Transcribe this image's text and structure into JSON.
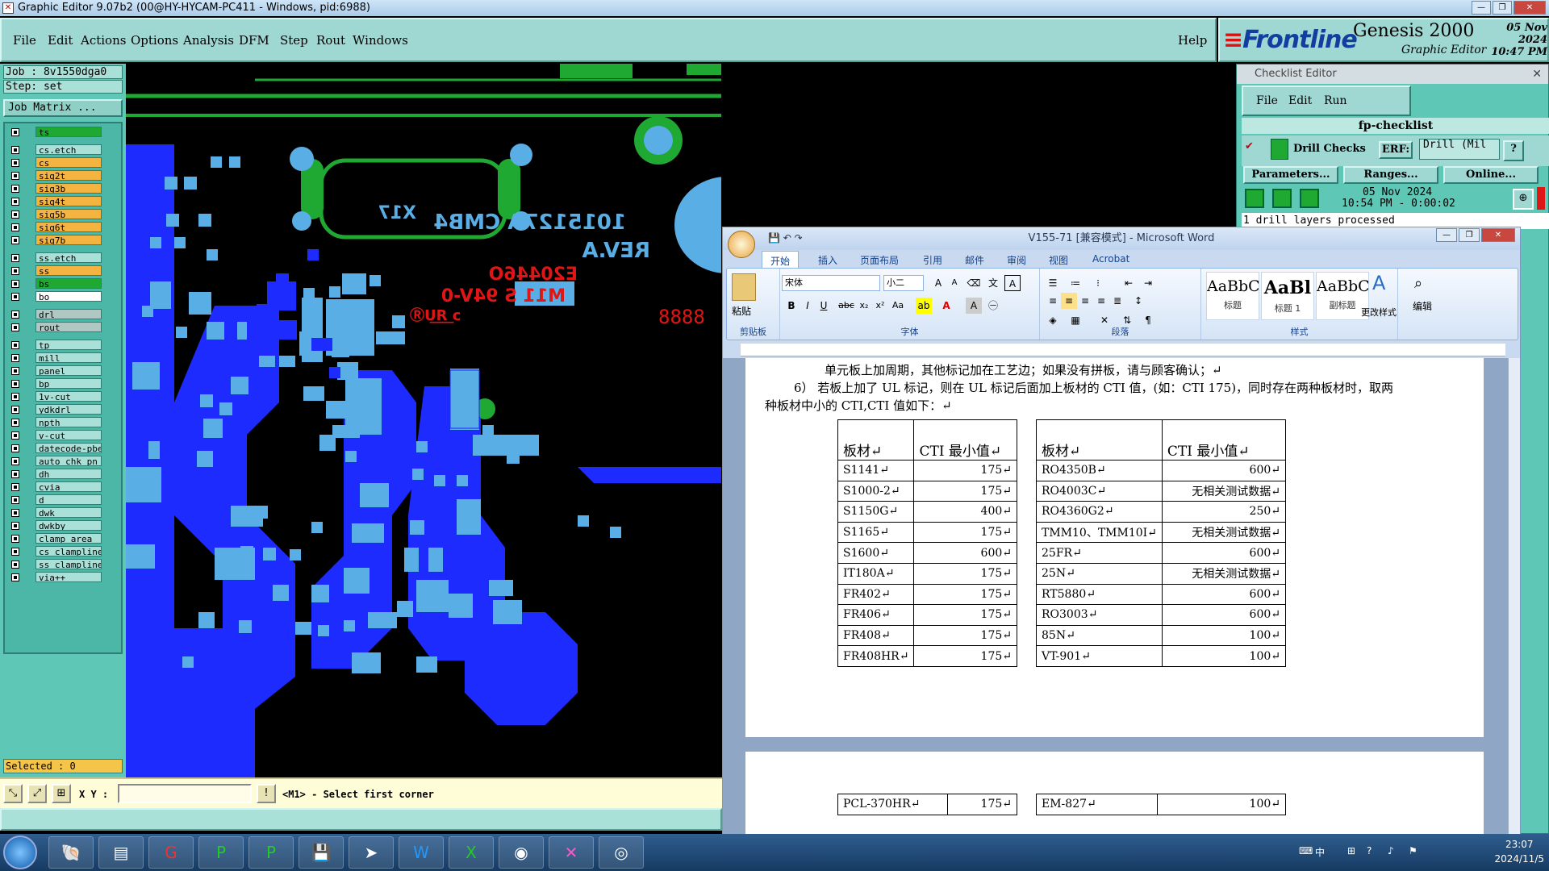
{
  "title_bar": {
    "text": "Graphic Editor 9.07b2 (00@HY-HYCAM-PC411 - Windows, pid:6988)"
  },
  "menu": {
    "items": [
      "File",
      "Edit",
      "Actions",
      "Options",
      "Analysis",
      "DFM",
      "Step",
      "Rout",
      "Windows"
    ],
    "help": "Help"
  },
  "brand": {
    "logo": "Frontline",
    "product": "Genesis 2000",
    "subtitle": "Graphic Editor",
    "date": "05 Nov 2024",
    "time": "10:47 PM"
  },
  "job": {
    "job": "Job : 8v1550dga0",
    "step": "Step: set",
    "matrix": "Job Matrix ..."
  },
  "layers": [
    {
      "name": "ts",
      "color": "#1fa832"
    },
    {
      "name": "cs.etch",
      "color": "#a9e0d8"
    },
    {
      "name": "cs",
      "color": "#f5b341"
    },
    {
      "name": "sig2t",
      "color": "#f5b341"
    },
    {
      "name": "sig3b",
      "color": "#f5b341"
    },
    {
      "name": "sig4t",
      "color": "#f5b341"
    },
    {
      "name": "sig5b",
      "color": "#f5b341"
    },
    {
      "name": "sig6t",
      "color": "#f5b341"
    },
    {
      "name": "sig7b",
      "color": "#f5b341"
    },
    {
      "name": "ss.etch",
      "color": "#a9e0d8"
    },
    {
      "name": "ss",
      "color": "#f5b341"
    },
    {
      "name": "bs",
      "color": "#1fa832"
    },
    {
      "name": "bo",
      "color": "#ffffff"
    },
    {
      "name": "drl",
      "color": "#b0c8c4"
    },
    {
      "name": "rout",
      "color": "#b0c8c4"
    },
    {
      "name": "tp",
      "color": "#a9e0d8"
    },
    {
      "name": "mill",
      "color": "#a9e0d8"
    },
    {
      "name": "panel",
      "color": "#a9e0d8"
    },
    {
      "name": "bp",
      "color": "#a9e0d8"
    },
    {
      "name": "1v-cut",
      "color": "#a9e0d8"
    },
    {
      "name": "ydkdrl",
      "color": "#a9e0d8"
    },
    {
      "name": "npth",
      "color": "#a9e0d8"
    },
    {
      "name": "v-cut",
      "color": "#a9e0d8"
    },
    {
      "name": "datecode-pbe",
      "color": "#a9e0d8"
    },
    {
      "name": "auto_chk_pn",
      "color": "#a9e0d8"
    },
    {
      "name": "dh",
      "color": "#a9e0d8"
    },
    {
      "name": "cvia",
      "color": "#a9e0d8"
    },
    {
      "name": "d",
      "color": "#a9e0d8"
    },
    {
      "name": "dwk",
      "color": "#a9e0d8"
    },
    {
      "name": "dwkby",
      "color": "#a9e0d8"
    },
    {
      "name": "clamp_area",
      "color": "#a9e0d8"
    },
    {
      "name": "cs_clampline",
      "color": "#a9e0d8"
    },
    {
      "name": "ss_clampline",
      "color": "#a9e0d8"
    },
    {
      "name": "via++",
      "color": "#a9e0d8"
    }
  ],
  "selected": "Selected : 0",
  "status": {
    "xy_label": "X Y :",
    "prompt": "<M1> - Select first corner"
  },
  "board_text": {
    "line1": "1015127A CMB4",
    "line2": "REV.A",
    "x17": "X17",
    "red1": "E20446O",
    "red2": "M11 S 94V-0",
    "red3": "8888"
  },
  "checklist": {
    "title": "Checklist Editor",
    "menu": [
      "File",
      "Edit",
      "Run"
    ],
    "name": "fp-checklist",
    "check": "Drill Checks",
    "erf_label": "ERF:",
    "erf_value": "Drill (Mil",
    "help": "?",
    "buttons": [
      "Parameters...",
      "Ranges...",
      "Online..."
    ],
    "date": "05 Nov 2024",
    "time": "10:54 PM - 0:00:02",
    "log": "1 drill layers processed"
  },
  "word": {
    "title": "V155-71 [兼容模式] - Microsoft Word",
    "tabs": [
      "开始",
      "插入",
      "页面布局",
      "引用",
      "邮件",
      "审阅",
      "视图",
      "Acrobat"
    ],
    "font": "宋体",
    "size": "小二",
    "groups": [
      "剪贴板",
      "字体",
      "段落",
      "样式",
      "编辑"
    ],
    "paste": "粘贴",
    "styles": [
      {
        "preview": "AaBbC(",
        "label": "标题"
      },
      {
        "preview": "AaBl",
        "label": "标题 1"
      },
      {
        "preview": "AaBbC(",
        "label": "副标题"
      }
    ],
    "change_style": "更改样式",
    "edit": "编辑",
    "para1": "单元板上加周期，其他标记加在工艺边；如果没有拼板，请与顾客确认；↵",
    "para2a": "6） 若板上加了 UL 标记，则在 UL 标记后面加上板材的 CTI 值，(如：CTI 175)，同时存在两种板材时，取两",
    "para2b": "种板材中小的 CTI,CTI 值如下：↵",
    "table_headers": [
      "板材↵",
      "CTI 最小值↵",
      "板材↵",
      "CTI 最小值↵"
    ],
    "table_rows": [
      [
        "S1141↵",
        "175↵",
        "RO4350B↵",
        "600↵"
      ],
      [
        "S1000-2↵",
        "175↵",
        "RO4003C↵",
        "无相关测试数据↵"
      ],
      [
        "S1150G↵",
        "400↵",
        "RO4360G2↵",
        "250↵"
      ],
      [
        "S1165↵",
        "175↵",
        "TMM10、TMM10I↵",
        "无相关测试数据↵"
      ],
      [
        "S1600↵",
        "600↵",
        "25FR↵",
        "600↵"
      ],
      [
        "IT180A↵",
        "175↵",
        "25N↵",
        "无相关测试数据↵"
      ],
      [
        "FR402↵",
        "175↵",
        "RT5880↵",
        "600↵"
      ],
      [
        "FR406↵",
        "175↵",
        "RO3003↵",
        "600↵"
      ],
      [
        "FR408↵",
        "175↵",
        "85N↵",
        "100↵"
      ],
      [
        "FR408HR↵",
        "175↵",
        "VT-901↵",
        "100↵"
      ]
    ],
    "page2_row": [
      "PCL-370HR↵",
      "175↵",
      "EM-827↵",
      "100↵"
    ]
  },
  "taskbar": {
    "time": "23:07",
    "date": "2024/11/5",
    "ime": "中"
  }
}
